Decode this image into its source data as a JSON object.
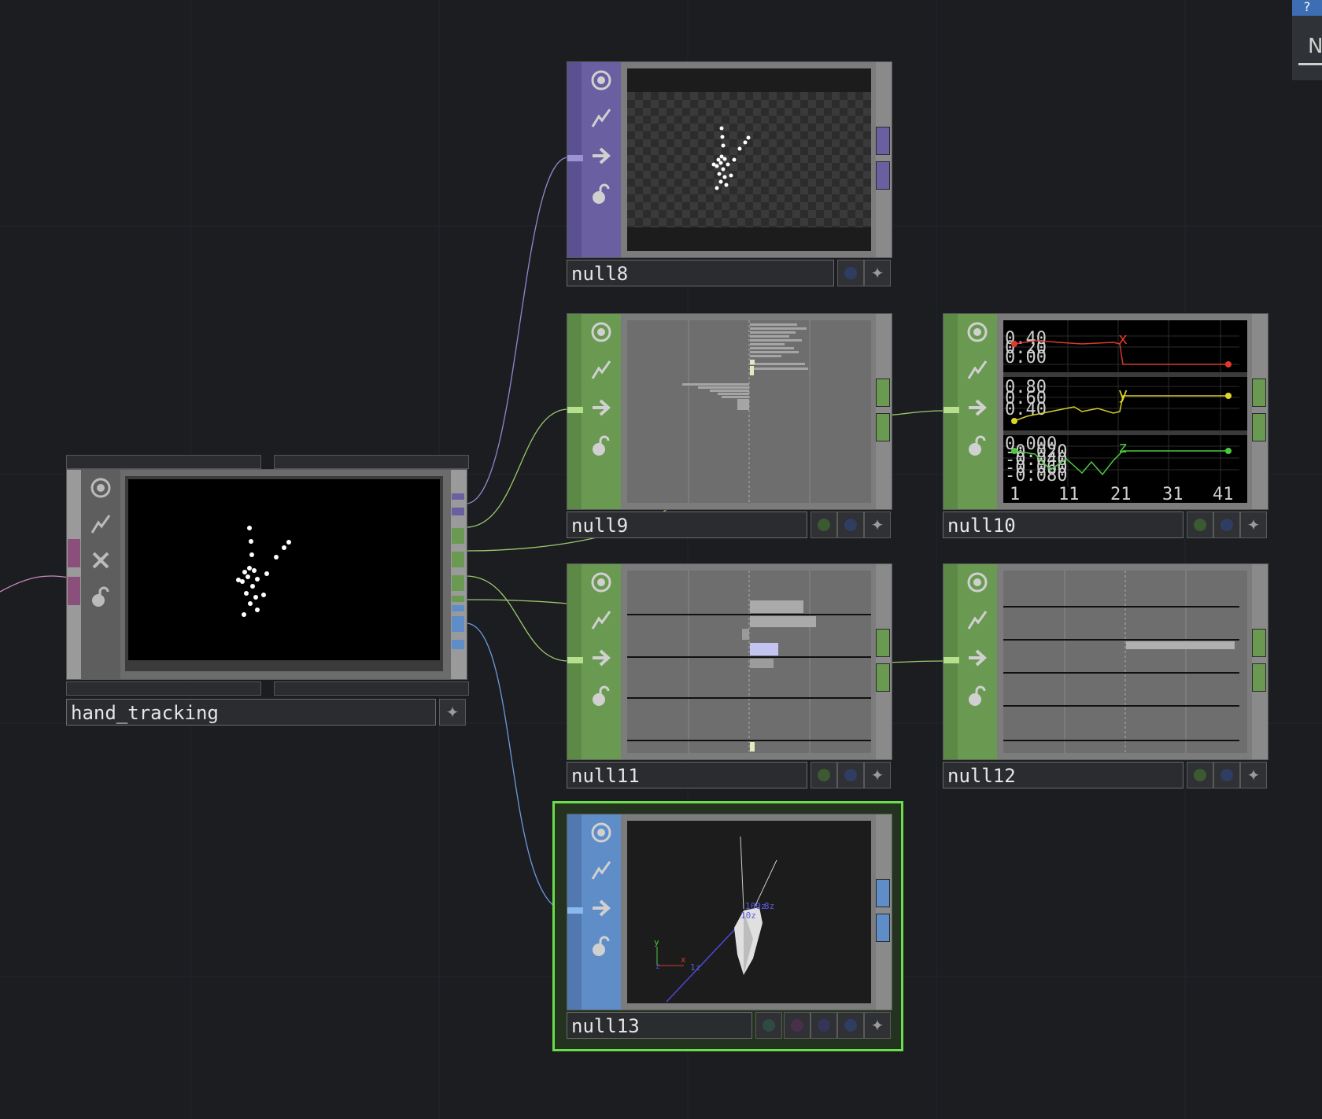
{
  "nodes": {
    "hand_tracking": {
      "label": "hand_tracking"
    },
    "null8": {
      "label": "null8"
    },
    "null9": {
      "label": "null9"
    },
    "null10": {
      "label": "null10",
      "x_channel": {
        "name": "x",
        "ticks": [
          "0.40",
          "0.20",
          "0.00"
        ]
      },
      "y_channel": {
        "name": "y",
        "ticks": [
          "0.80",
          "0.60",
          "0.40"
        ]
      },
      "z_channel": {
        "name": "z",
        "ticks": [
          "0.000",
          "-0.020",
          "-0.040",
          "-0.060",
          "-0.080"
        ]
      },
      "x_axis": [
        "1",
        "11",
        "21",
        "31",
        "41"
      ]
    },
    "null11": {
      "label": "null11"
    },
    "null12": {
      "label": "null12"
    },
    "null13": {
      "label": "null13",
      "axis_labels": {
        "y": "y",
        "x": "x",
        "z": "z",
        "one_z": "1z",
        "ten_z": "10z",
        "hundred_z": "100z",
        "eight_z": "8z"
      }
    }
  },
  "corner_panel": {
    "letter": "N",
    "badge": "?"
  },
  "colors": {
    "top_family": "#6a5fa0",
    "chop_family": "#6a9a52",
    "sop_family": "#5f8dc8",
    "comp_family": "#8a4f7a",
    "selection": "#6bdc4a"
  },
  "icons": [
    "viewer-icon",
    "cook-icon",
    "export-icon",
    "lock-icon",
    "bypass-icon",
    "pin-icon"
  ]
}
